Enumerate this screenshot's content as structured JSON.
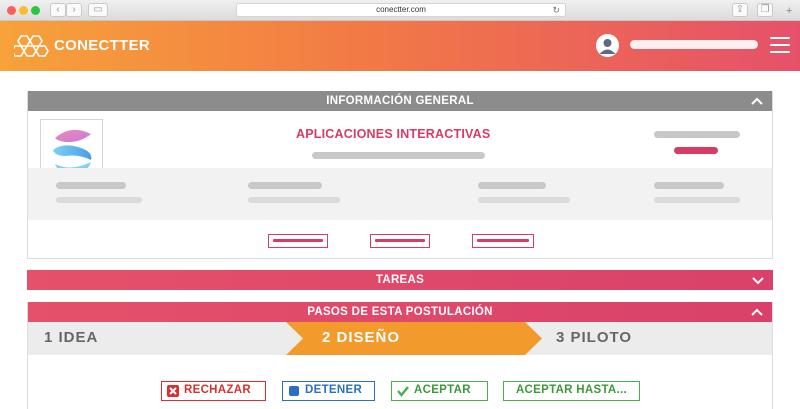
{
  "browser": {
    "url": "conectter.com"
  },
  "header": {
    "brand": "CONECTTER"
  },
  "general": {
    "title": "INFORMACIÓN GENERAL",
    "app_name": "APLICACIONES INTERACTIVAS"
  },
  "tasks": {
    "title": "TAREAS"
  },
  "steps": {
    "title": "PASOS DE ESTA POSTULACIÓN",
    "items": [
      "1 IDEA",
      "2 DISEÑO",
      "3 PILOTO"
    ],
    "active_index": 1
  },
  "actions": {
    "reject": "RECHAZAR",
    "stop": "DETENER",
    "accept": "ACEPTAR",
    "accept_until": "ACEPTAR HASTA..."
  },
  "colors": {
    "accent_pink": "#d83b63",
    "accent_orange": "#f7a23a",
    "step_active": "#f39a2c",
    "reject_red": "#d83030",
    "stop_blue": "#2a6fc1",
    "accept_green": "#4bb04b"
  },
  "icons": {
    "logo": "hexagon-cluster-icon",
    "avatar": "user-avatar-icon",
    "menu": "hamburger-icon",
    "collapse": "chevron-up-icon",
    "expand": "chevron-down-icon",
    "reject": "x-icon",
    "stop": "stop-square-icon",
    "accept": "check-icon"
  }
}
